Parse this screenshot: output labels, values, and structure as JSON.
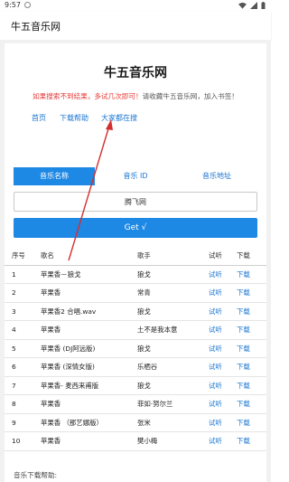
{
  "status": {
    "time": "9:57"
  },
  "app": {
    "title": "牛五音乐网"
  },
  "site": {
    "title": "牛五音乐网",
    "notice_red": "如果搜索不到结果，多试几次即可！",
    "notice_gray": "请收藏牛五音乐网，加入书签！"
  },
  "nav": {
    "home": "首页",
    "download_help": "下载帮助",
    "everyone_search": "大家都在搜"
  },
  "tabs": [
    {
      "label": "音乐名称"
    },
    {
      "label": "音乐 ID"
    },
    {
      "label": "音乐地址"
    }
  ],
  "search": {
    "value": "腾飞网"
  },
  "get_button": "Get √",
  "table": {
    "headers": {
      "no": "序号",
      "song": "歌名",
      "singer": "歌手",
      "listen": "试听",
      "download": "下载"
    },
    "rows": [
      {
        "no": "1",
        "song": "苹果香－狼戈",
        "singer": "狼戈",
        "listen": "试听",
        "download": "下载"
      },
      {
        "no": "2",
        "song": "苹果香",
        "singer": "常青",
        "listen": "试听",
        "download": "下载"
      },
      {
        "no": "3",
        "song": "苹果香2 合唱.wav",
        "singer": "狼戈",
        "listen": "试听",
        "download": "下载"
      },
      {
        "no": "4",
        "song": "苹果香",
        "singer": "土不是我本意",
        "listen": "试听",
        "download": "下载"
      },
      {
        "no": "5",
        "song": "苹果香 (DJ阿远版)",
        "singer": "狼戈",
        "listen": "试听",
        "download": "下载"
      },
      {
        "no": "6",
        "song": "苹果香 (深情女版)",
        "singer": "乐栖谷",
        "listen": "试听",
        "download": "下载"
      },
      {
        "no": "7",
        "song": "苹果香- 麦西来甫版",
        "singer": "狼戈",
        "listen": "试听",
        "download": "下载"
      },
      {
        "no": "8",
        "song": "苹果香",
        "singer": "菲如·努尔兰",
        "listen": "试听",
        "download": "下载"
      },
      {
        "no": "9",
        "song": "苹果香 （那艺娜版）",
        "singer": "张米",
        "listen": "试听",
        "download": "下载"
      },
      {
        "no": "10",
        "song": "苹果香",
        "singer": "樊小梅",
        "listen": "试听",
        "download": "下载"
      }
    ]
  },
  "help": {
    "label": "音乐下载帮助:"
  },
  "colors": {
    "accent": "#1e88e5",
    "link": "#1976d2",
    "notice_red": "#e53935",
    "annotation_arrow": "#d32f2f"
  }
}
